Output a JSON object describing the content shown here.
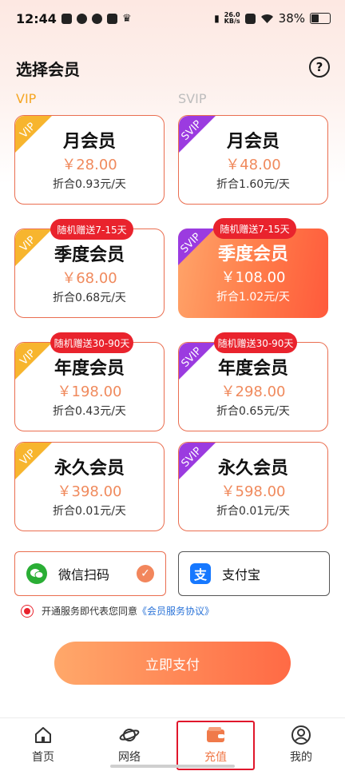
{
  "status_bar": {
    "time": "12:44",
    "net_speed_value": "26.0",
    "net_speed_unit": "KB/s",
    "battery": "38%"
  },
  "header": {
    "title": "选择会员",
    "help_icon": "question-circle-icon"
  },
  "columns": {
    "vip_label": "VIP",
    "svip_label": "SVIP"
  },
  "plans": {
    "vip_month": {
      "corner": "VIP",
      "name": "月会员",
      "price": "￥28.00",
      "rate": "折合0.93元/天",
      "badge": ""
    },
    "svip_month": {
      "corner": "SVIP",
      "name": "月会员",
      "price": "￥48.00",
      "rate": "折合1.60元/天",
      "badge": ""
    },
    "vip_quarter": {
      "corner": "VIP",
      "name": "季度会员",
      "price": "￥68.00",
      "rate": "折合0.68元/天",
      "badge": "随机赠送7-15天"
    },
    "svip_quarter": {
      "corner": "SVIP",
      "name": "季度会员",
      "price": "￥108.00",
      "rate": "折合1.02元/天",
      "badge": "随机赠送7-15天"
    },
    "vip_year": {
      "corner": "VIP",
      "name": "年度会员",
      "price": "￥198.00",
      "rate": "折合0.43元/天",
      "badge": "随机赠送30-90天"
    },
    "svip_year": {
      "corner": "SVIP",
      "name": "年度会员",
      "price": "￥298.00",
      "rate": "折合0.65元/天",
      "badge": "随机赠送30-90天"
    },
    "vip_forever": {
      "corner": "VIP",
      "name": "永久会员",
      "price": "￥398.00",
      "rate": "折合0.01元/天",
      "badge": ""
    },
    "svip_forever": {
      "corner": "SVIP",
      "name": "永久会员",
      "price": "￥598.00",
      "rate": "折合0.01元/天",
      "badge": ""
    }
  },
  "payment": {
    "wechat_label": "微信扫码",
    "alipay_label": "支付宝",
    "selected": "wechat"
  },
  "agreement": {
    "text": "开通服务即代表您同意",
    "link": "《会员服务协议》"
  },
  "pay_button": "立即支付",
  "tabs": {
    "home": "首页",
    "network": "网络",
    "recharge": "充值",
    "mine": "我的"
  },
  "colors": {
    "accent": "#f07a4a",
    "card_border": "#ea6e50",
    "vip_corner": "#f7b52e",
    "svip_corner": "#9b3be0",
    "badge": "#e9232d"
  }
}
